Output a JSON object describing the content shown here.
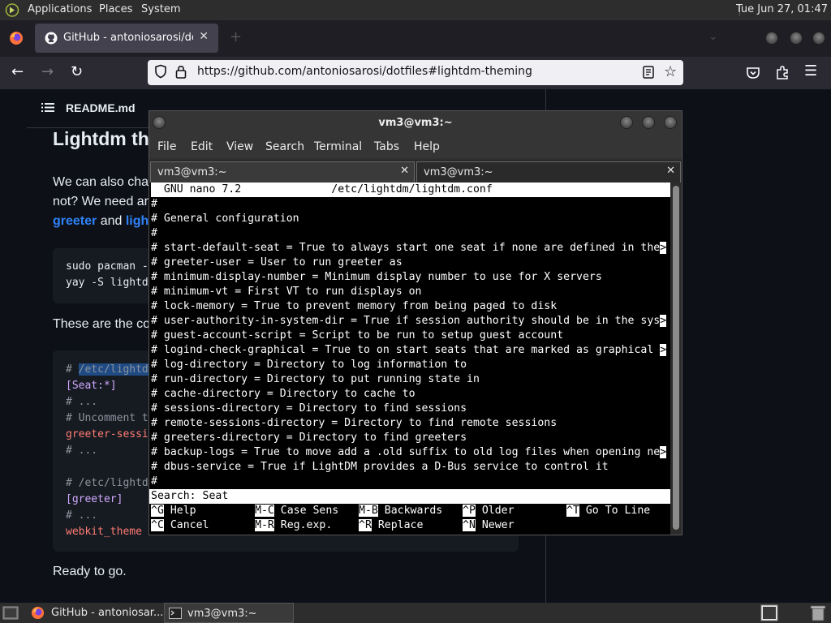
{
  "top_panel": {
    "menus": [
      "Applications",
      "Places",
      "System"
    ],
    "clock": "Tue Jun 27, 01:47"
  },
  "browser": {
    "tab_title": "GitHub - antoniosarosi/dotf",
    "url": "https://github.com/antoniosarosi/dotfiles#lightdm-theming"
  },
  "github": {
    "readme_label": "README.md",
    "heading": "Lightdm th",
    "para1_line1": "We can also cha",
    "para1_line2": "not? We need ar",
    "link_greeter": "greeter",
    "word_and": "and",
    "link_ligh": "ligh",
    "code1": [
      "sudo pacman -",
      "yay -S lightd"
    ],
    "para2": "These are the co",
    "code2": {
      "l1_prefix": "# ",
      "l1_hl": "/etc/lightd",
      "l2": "[Seat:*]",
      "l3": "# ...",
      "l4": "# Uncomment t",
      "l5": "greeter-sessi",
      "l6": "# ...",
      "l8": "# /etc/lightd",
      "l9": "[greeter]",
      "l10": "# ...",
      "l11": "webkit_theme"
    },
    "para3": "Ready to go."
  },
  "terminal": {
    "title": "vm3@vm3:~",
    "menu": [
      "File",
      "Edit",
      "View",
      "Search",
      "Terminal",
      "Tabs",
      "Help"
    ],
    "tabs": [
      "vm3@vm3:~",
      "vm3@vm3:~"
    ],
    "nano_header": "  GNU nano 7.2              /etc/lightdm/lightdm.conf",
    "lines": [
      "#",
      "# General configuration",
      "#",
      "# start-default-seat = True to always start one seat if none are defined in the",
      "# greeter-user = User to run greeter as",
      "# minimum-display-number = Minimum display number to use for X servers",
      "# minimum-vt = First VT to run displays on",
      "# lock-memory = True to prevent memory from being paged to disk",
      "# user-authority-in-system-dir = True if session authority should be in the sys",
      "# guest-account-script = Script to be run to setup guest account",
      "# logind-check-graphical = True to on start seats that are marked as graphical ",
      "# log-directory = Directory to log information to",
      "# run-directory = Directory to put running state in",
      "# cache-directory = Directory to cache to",
      "# sessions-directory = Directory to find sessions",
      "# remote-sessions-directory = Directory to find remote sessions",
      "# greeters-directory = Directory to find greeters",
      "# backup-logs = True to move add a .old suffix to old log files when opening ne",
      "# dbus-service = True if LightDM provides a D-Bus service to control it",
      "#"
    ],
    "overflow_marker": ">",
    "search_prompt": "Search: Seat",
    "shortcuts_row1": [
      {
        "key": "^G",
        "label": "Help"
      },
      {
        "key": "M-C",
        "label": "Case Sens"
      },
      {
        "key": "M-B",
        "label": "Backwards"
      },
      {
        "key": "^P",
        "label": "Older"
      },
      {
        "key": "^T",
        "label": "Go To Line"
      }
    ],
    "shortcuts_row2": [
      {
        "key": "^C",
        "label": "Cancel"
      },
      {
        "key": "M-R",
        "label": "Reg.exp."
      },
      {
        "key": "^R",
        "label": "Replace"
      },
      {
        "key": "^N",
        "label": "Newer"
      }
    ]
  },
  "taskbar": {
    "items": [
      "GitHub - antoniosar...",
      "vm3@vm3:~"
    ]
  }
}
